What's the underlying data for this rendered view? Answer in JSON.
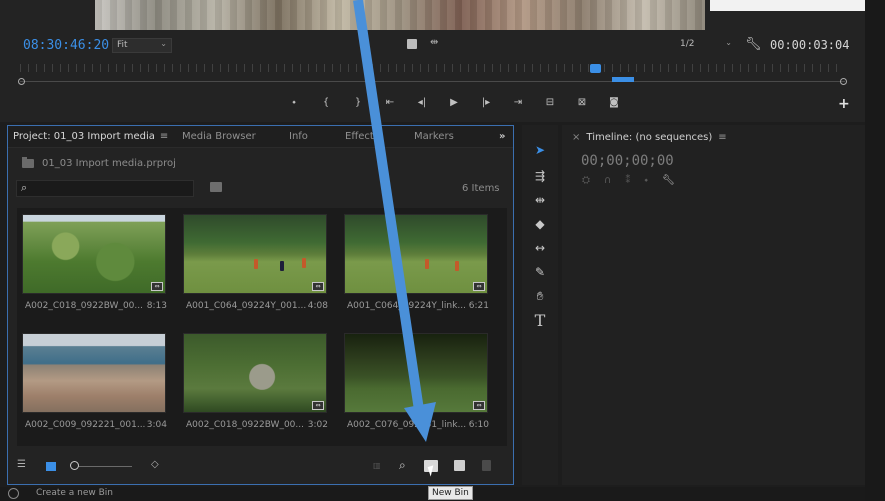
{
  "monitor": {
    "timecode_left": "08:30:46:20",
    "fit_label": "Fit",
    "resolution_label": "1/2",
    "timecode_right": "00:00:03:04",
    "transport": [
      "⬩",
      "{",
      "}",
      "⇤",
      "◂|",
      "▶",
      "|▸",
      "⇥",
      "⊟",
      "⊠",
      "◙"
    ],
    "add_label": "+"
  },
  "project": {
    "tabs": {
      "project": "Project: 01_03 Import media",
      "project_menu": "≡",
      "media_browser": "Media Browser",
      "info": "Info",
      "effects": "Effects",
      "markers": "Markers",
      "more": "»"
    },
    "file_name": "01_03 Import media.prproj",
    "search_placeholder": "",
    "items_count": "6 Items",
    "clips": [
      {
        "name": "A002_C018_0922BW_00...",
        "duration": "8:13",
        "thumb": "t-forest"
      },
      {
        "name": "A001_C064_09224Y_001...",
        "duration": "4:08",
        "thumb": "t-field"
      },
      {
        "name": "A001_C064_09224Y_link...",
        "duration": "6:21",
        "thumb": "t-field"
      },
      {
        "name": "A002_C009_092221_001...",
        "duration": "3:04",
        "thumb": "t-city"
      },
      {
        "name": "A002_C018_0922BW_00...",
        "duration": "3:02",
        "thumb": "t-ruins"
      },
      {
        "name": "A002_C076_092251_link...",
        "duration": "6:10",
        "thumb": "t-trees"
      }
    ],
    "badge_label": "⇔"
  },
  "timeline": {
    "close": "×",
    "title": "Timeline: (no sequences)",
    "menu": "≡",
    "timecode": "00;00;00;00"
  },
  "status": {
    "text": "Create a new Bin",
    "tooltip": "New Bin"
  },
  "colors": {
    "accent": "#3b8fe6",
    "arrow": "#4a90d9"
  }
}
